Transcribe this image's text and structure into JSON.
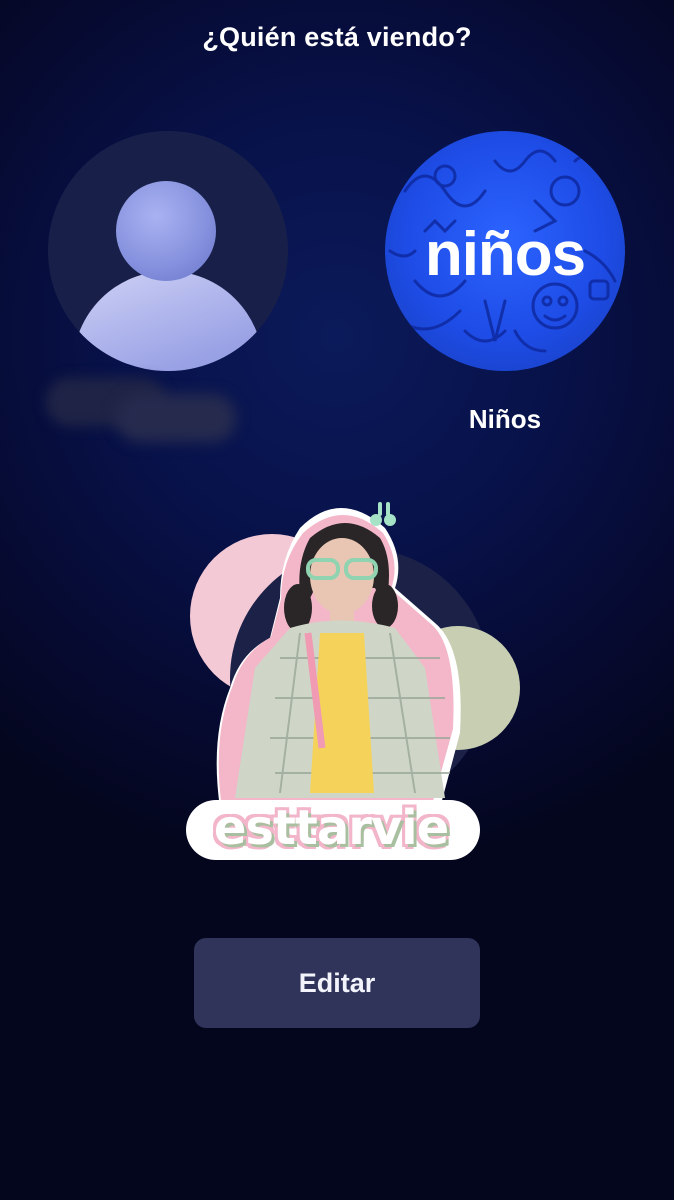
{
  "header": {
    "title": "¿Quién está viendo?"
  },
  "profiles": [
    {
      "id": "primary",
      "icon": "person-avatar-icon"
    },
    {
      "id": "kids",
      "avatar_text": "niños",
      "name": "Niños",
      "icon": "kids-doodle-avatar"
    },
    {
      "id": "sticker",
      "sticker_text": "esttarvie",
      "icon": "girl-sticker-avatar"
    }
  ],
  "actions": {
    "edit_label": "Editar"
  },
  "colors": {
    "background": "#060a30",
    "kids_blue": "#1e4ce6",
    "button_bg": "#30345a",
    "sticker_pink": "#f4c9d6",
    "sticker_sage": "#c8ceb1"
  }
}
